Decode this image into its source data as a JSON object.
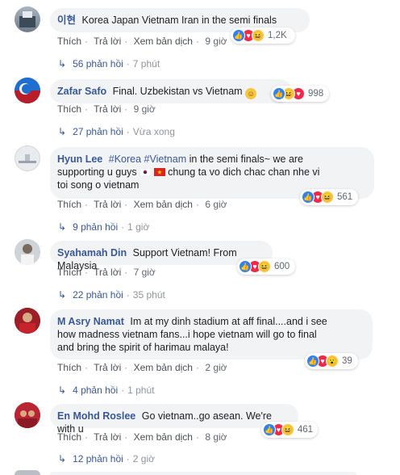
{
  "comments": [
    {
      "author": "이현",
      "text": "Korea Japan Vietnam Iran in the semi finals",
      "actions": [
        "Thích",
        "Trả lời",
        "Xem bản dịch",
        "9 giờ"
      ],
      "reaction_count": "1,2K",
      "reactions": [
        "like",
        "love",
        "haha"
      ],
      "replies_count": "56 phản hồi",
      "replies_time": "7 phút"
    },
    {
      "author": "Zafar Safo",
      "text": "Final. Uzbekistan vs Vietnam",
      "actions": [
        "Thích",
        "Trả lời",
        "9 giờ"
      ],
      "reaction_count": "998",
      "reactions": [
        "like",
        "haha",
        "love"
      ],
      "replies_count": "27 phản hồi",
      "replies_time": "Vừa xong"
    },
    {
      "author": "Hyun Lee",
      "tags": [
        "#Korea",
        "#Vietnam"
      ],
      "text_a": "in the semi finals~ we are",
      "text_b": "supporting u guys",
      "text_c": "chung ta vo dich chac chan nhe vi",
      "text_d": "toi song o vietnam",
      "actions": [
        "Thích",
        "Trả lời",
        "Xem bản dịch",
        "6 giờ"
      ],
      "reaction_count": "561",
      "reactions": [
        "like",
        "love",
        "haha"
      ],
      "replies_count": "9 phản hồi",
      "replies_time": "1 giờ"
    },
    {
      "author": "Syahamah Din",
      "text": "Support Vietnam! From Malaysia",
      "actions": [
        "Thích",
        "Trả lời",
        "7 giờ"
      ],
      "reaction_count": "600",
      "reactions": [
        "like",
        "love",
        "haha"
      ],
      "replies_count": "22 phản hồi",
      "replies_time": "35 phút"
    },
    {
      "author": "M Asry Namat",
      "text_a": "Im at my dinh stadium at aff final....and i see",
      "text_b": "how madness vietnam fans...i hope vietnam will go to final",
      "text_c": "and bring the spirit of harimau malaya!",
      "actions": [
        "Thích",
        "Trả lời",
        "Xem bản dịch",
        "2 giờ"
      ],
      "reaction_count": "39",
      "reactions": [
        "like",
        "love",
        "wow"
      ],
      "replies_count": "4 phản hồi",
      "replies_time": "1 phút"
    },
    {
      "author": "En Mohd Roslee",
      "text": "Go vietnam..go asean. We're with u",
      "actions": [
        "Thích",
        "Trả lời",
        "Xem bản dịch",
        "8 giờ"
      ],
      "reaction_count": "461",
      "reactions": [
        "like",
        "love",
        "haha"
      ],
      "replies_count": "12 phản hồi",
      "replies_time": "2 giờ"
    }
  ],
  "colors": {
    "link": "#385898",
    "bubble": "#f2f3f5",
    "like": "#2f81f7",
    "love": "#f0284a",
    "haha": "#f7c640"
  }
}
